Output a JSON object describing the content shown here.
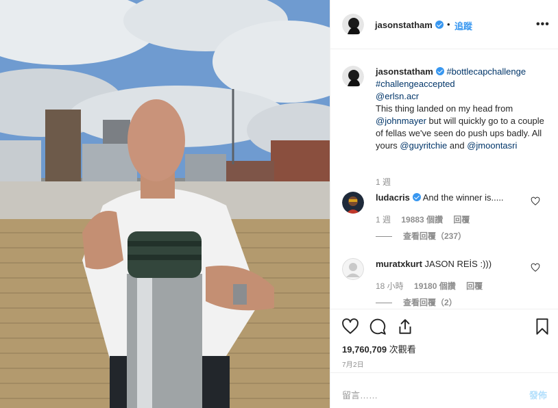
{
  "post": {
    "author": "jasonstatham",
    "follow_label": "追蹤",
    "more_label": "•••",
    "dot": "•"
  },
  "caption": {
    "author": "jasonstatham",
    "hashtag1": "#bottlecapchallenge",
    "hashtag2": "#challengeaccepted",
    "mention1": "@erlsn.acr",
    "text1": "This thing landed on my head from",
    "mention2": "@johnmayer",
    "text2": "but will quickly go to a couple of fellas we've seen do push ups badly. All yours",
    "mention3": "@guyritchie",
    "text3": "and",
    "mention4": "@jmoontasri",
    "time": "1 週"
  },
  "comments": [
    {
      "author": "ludacris",
      "verified": true,
      "text": "And the winner is.....",
      "time": "1 週",
      "likes": "19883 個讚",
      "reply_label": "回覆",
      "view_replies": "查看回覆（237）"
    },
    {
      "author": "muratxkurt",
      "verified": false,
      "text": "JASON REİS :)))",
      "time": "18 小時",
      "likes": "19180 個讚",
      "reply_label": "回覆",
      "view_replies": "查看回覆（2）"
    }
  ],
  "stats": {
    "views_count": "19,760,709",
    "views_label": "次觀看",
    "date": "7月2日"
  },
  "add_comment": {
    "placeholder": "留言……",
    "post_label": "發佈"
  },
  "icons": {
    "heart": "heart-icon",
    "comment": "comment-icon",
    "share": "share-icon",
    "save": "bookmark-icon",
    "verified": "verified-badge-icon",
    "more": "more-options-icon"
  },
  "colors": {
    "link_blue": "#3897f0",
    "tag_blue": "#003569",
    "muted": "#8e8e8e",
    "post_disabled": "#b2dffc"
  }
}
